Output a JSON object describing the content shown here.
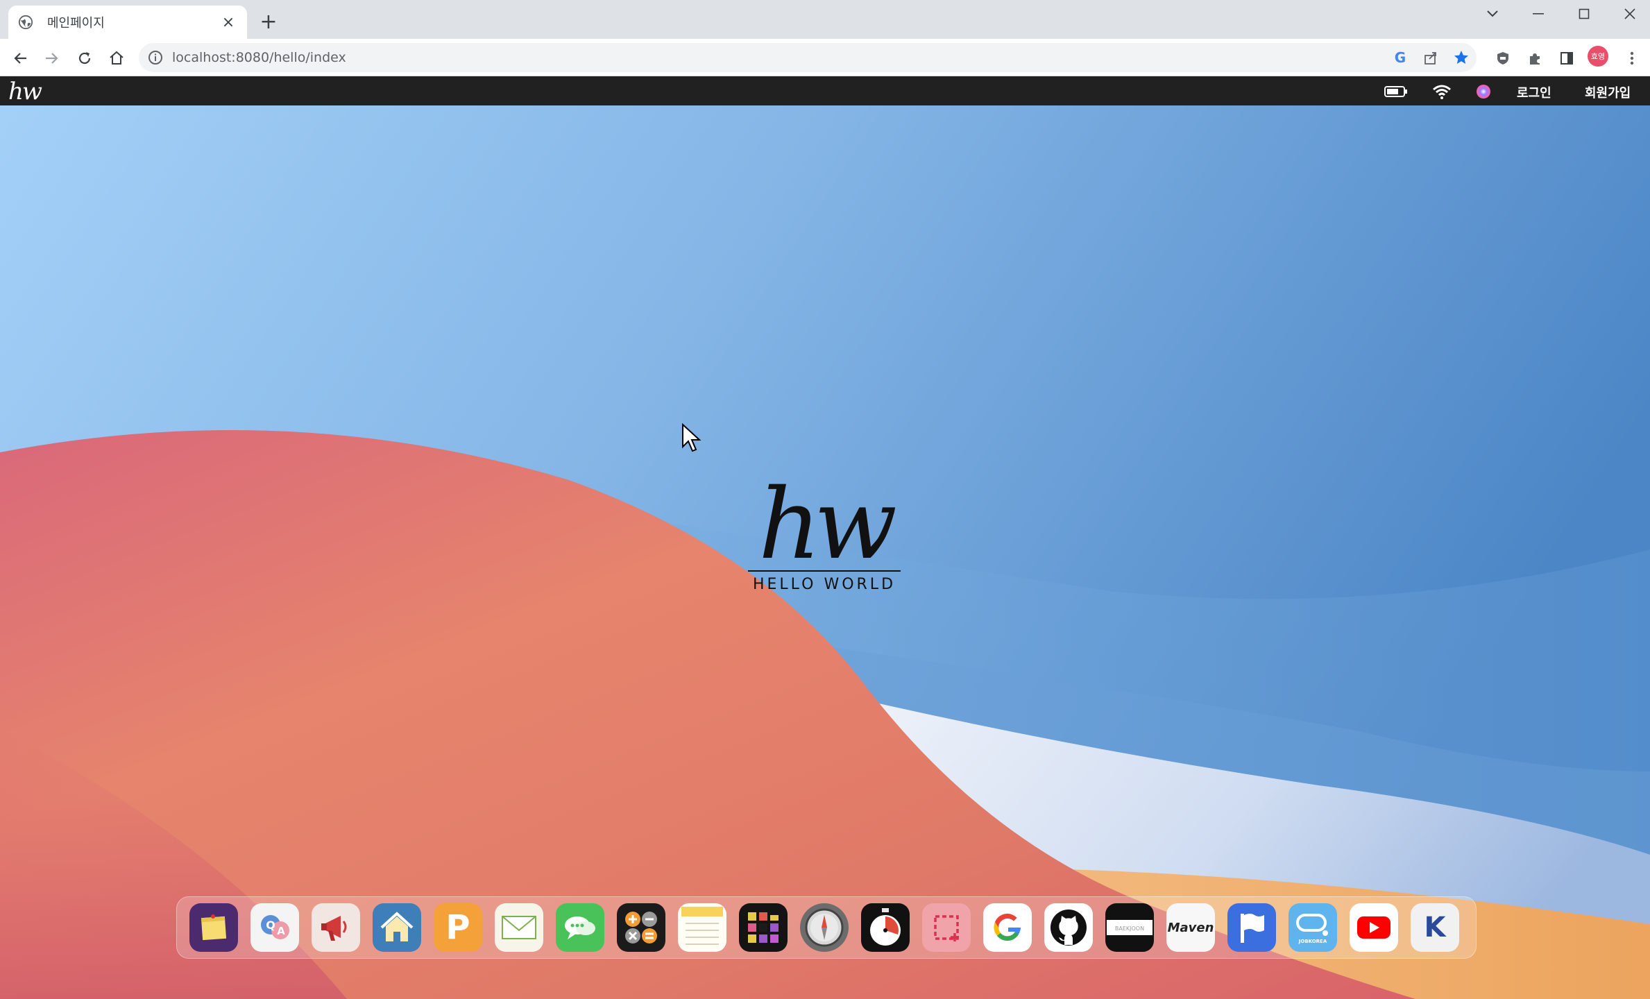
{
  "browser": {
    "tab_title": "메인페이지",
    "tab_close": "×",
    "new_tab": "+",
    "url": "localhost:8080/hello/index",
    "profile_initials": "효영"
  },
  "menubar": {
    "logo_text": "hw",
    "login": "로그인",
    "signup": "회원가입"
  },
  "hero": {
    "script": "hw",
    "subtitle": "HELLO WORLD"
  },
  "dock": {
    "items": [
      {
        "name": "notes",
        "icon": "sticky-note-icon"
      },
      {
        "name": "qna",
        "icon": "qa-icon",
        "text": "Q A"
      },
      {
        "name": "announcements",
        "icon": "megaphone-icon"
      },
      {
        "name": "home",
        "icon": "house-icon"
      },
      {
        "name": "points",
        "icon": "p-icon",
        "text": "P"
      },
      {
        "name": "mail",
        "icon": "envelope-icon"
      },
      {
        "name": "chat",
        "icon": "chat-bubbles-icon"
      },
      {
        "name": "calculator",
        "icon": "calculator-icon"
      },
      {
        "name": "memo",
        "icon": "lined-paper-icon"
      },
      {
        "name": "puzzle",
        "icon": "blocks-icon"
      },
      {
        "name": "compass",
        "icon": "compass-icon"
      },
      {
        "name": "timer",
        "icon": "stopwatch-icon"
      },
      {
        "name": "capture",
        "icon": "crop-icon"
      },
      {
        "name": "google",
        "icon": "google-icon",
        "text": "G"
      },
      {
        "name": "github",
        "icon": "github-icon"
      },
      {
        "name": "baekjoon",
        "icon": "baekjoon-icon"
      },
      {
        "name": "maven",
        "icon": "maven-icon",
        "text": "Maven"
      },
      {
        "name": "flag",
        "icon": "flag-icon"
      },
      {
        "name": "jobkorea",
        "icon": "jobkorea-icon"
      },
      {
        "name": "youtube",
        "icon": "youtube-icon"
      },
      {
        "name": "k-app",
        "icon": "k-logo-icon",
        "text": "K"
      }
    ]
  },
  "colors": {
    "menubar_bg": "#212121",
    "sky_top": "#9ccaf4",
    "sky_right": "#4a83c4",
    "dune": "#e07a6f",
    "accent_star": "#1a73e8"
  }
}
